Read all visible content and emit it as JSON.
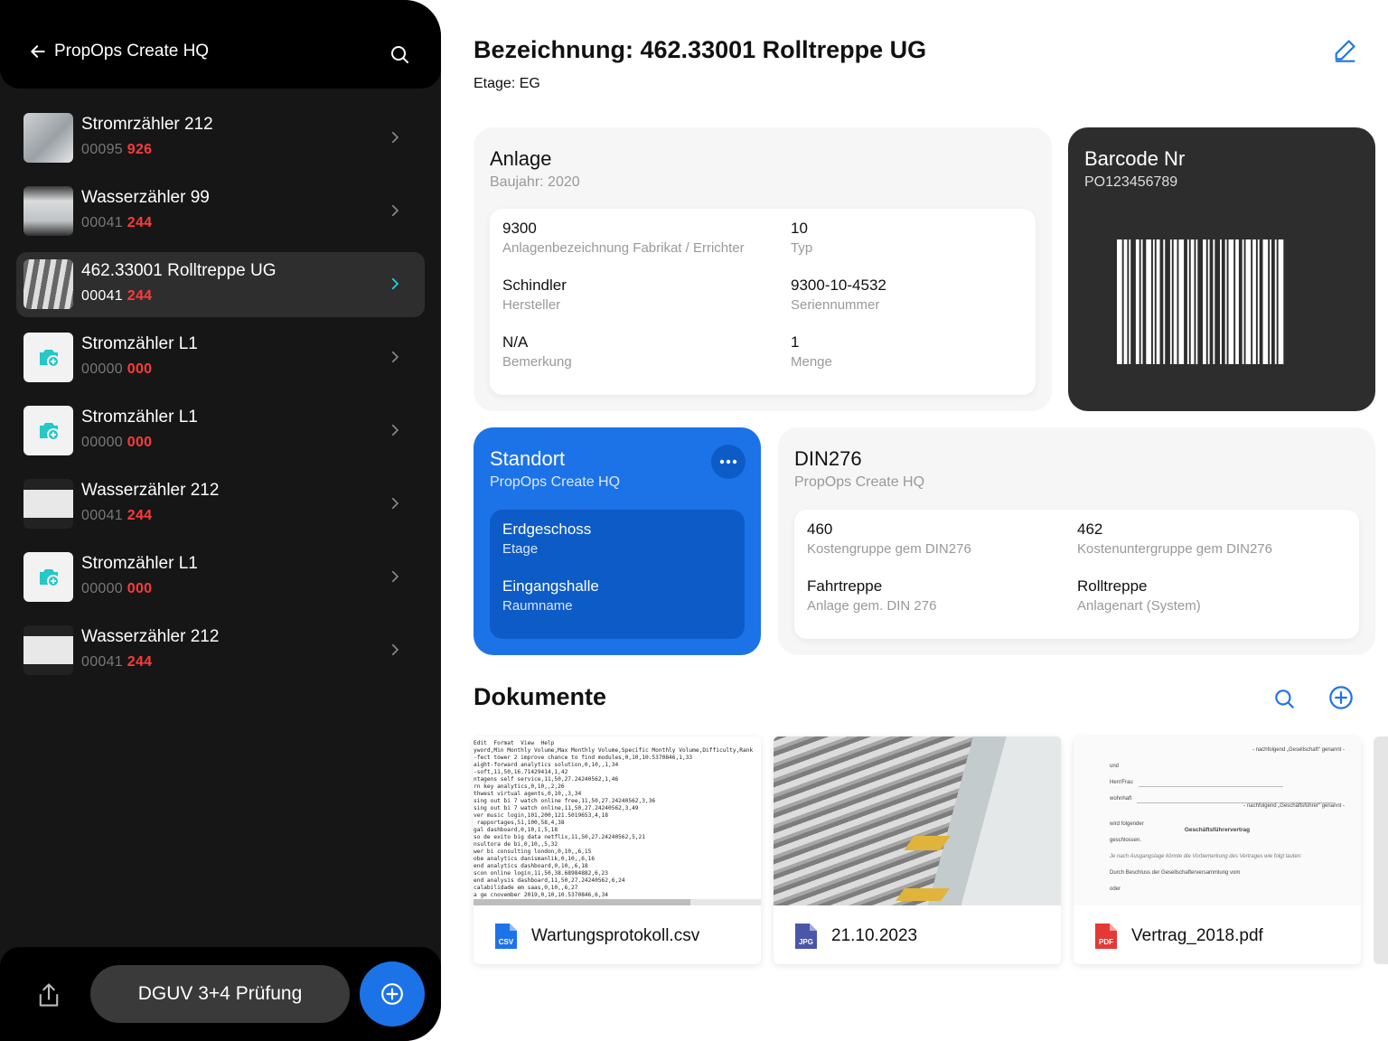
{
  "sidebar": {
    "back_label": "PropOps Create HQ",
    "items": [
      {
        "title": "Stromrzähler 212",
        "code": "00095",
        "reading": "926"
      },
      {
        "title": "Wasserzähler 99",
        "code": "00041",
        "reading": "244"
      },
      {
        "title": "462.33001 Rolltreppe UG",
        "code": "00041",
        "reading": "244"
      },
      {
        "title": "Stromzähler L1",
        "code": "00000",
        "reading": "000"
      },
      {
        "title": "Stromzähler L1",
        "code": "00000",
        "reading": "000"
      },
      {
        "title": "Wasserzähler 212",
        "code": "00041",
        "reading": "244"
      },
      {
        "title": "Stromzähler L1",
        "code": "00000",
        "reading": "000"
      },
      {
        "title": "Wasserzähler 212",
        "code": "00041",
        "reading": "244"
      }
    ],
    "footer": {
      "action_label": "DGUV 3+4 Prüfung"
    }
  },
  "header": {
    "title": "Bezeichnung: 462.33001 Rolltreppe UG",
    "etage": "Etage: EG"
  },
  "anlage": {
    "title": "Anlage",
    "subtitle": "Baujahr: 2020",
    "fields": [
      {
        "value": "9300",
        "label": "Anlagenbezeichnung Fabrikat / Errichter"
      },
      {
        "value": "10",
        "label": "Typ"
      },
      {
        "value": "Schindler",
        "label": "Hersteller"
      },
      {
        "value": "9300-10-4532",
        "label": "Seriennummer"
      },
      {
        "value": "N/A",
        "label": "Bemerkung"
      },
      {
        "value": "1",
        "label": "Menge"
      }
    ]
  },
  "barcode": {
    "title": "Barcode Nr",
    "number": "PO123456789"
  },
  "standort": {
    "title": "Standort",
    "subtitle": "PropOps Create HQ",
    "fields": [
      {
        "value": "Erdgeschoss",
        "label": "Etage"
      },
      {
        "value": "Eingangshalle",
        "label": "Raumname"
      }
    ]
  },
  "din276": {
    "title": "DIN276",
    "subtitle": "PropOps Create HQ",
    "fields": [
      {
        "value": "460",
        "label": "Kostengruppe gem DIN276"
      },
      {
        "value": "462",
        "label": "Kostenuntergruppe gem DIN276"
      },
      {
        "value": "Fahrtreppe",
        "label": "Anlage gem. DIN 276"
      },
      {
        "value": "Rolltreppe",
        "label": "Anlagenart (System)"
      }
    ]
  },
  "documents": {
    "title": "Dokumente",
    "items": [
      {
        "name": "Wartungsprotokoll.csv",
        "type": "CSV",
        "color": "#1c73e8"
      },
      {
        "name": "21.10.2023",
        "type": "JPG",
        "color": "#4a56a8"
      },
      {
        "name": "Vertrag_2018.pdf",
        "type": "PDF",
        "color": "#e53935"
      }
    ],
    "csv_preview": "Edit  Format  View  Help\nyword,Min Monthly Volume,Max Monthly Volume,Specific Monthly Volume,Difficulty,Rank\n-fect tower 2 improve chance to find modules,0,10,10.5370846,1,33\naight-forward analytics solution,0,10,,1,34\n-soft,11,50,16.71429414,1,42\nntagens self service,11,50,27.24240562,1,46\nrn key analytics,0,10,,2,26\nthwest virtual agents,0,10,,3,34\nsing out bi 7 watch online free,11,50,27.24240562,3,36\nsing out bi 7 watch online,11,50,27.24240562,3,49\nver music login,101,200,121.5019653,4,18\n rapportages,51,100,58,4,38\ngal dashboard,0,10,1,5,18\nso de exito big data netflix,11,50,27.24240562,5,21\nnsultora de bi,0,10,,5,32\nwer bi consulting london,0,10,,6,15\nobe analytics danismanlik,0,10,,6,16\nend analytics dashboard,0,10,,6,18\nscon online login,11,50,38.68984882,6,23\nend analysis dashboard,11,50,27.24240562,6,24\ncalabilidade em saas,0,10,,6,27\na ge cnovember 2019,0,10,10.5370846,6,34",
    "pdf_preview": {
      "line1": "- nachfolgend „Gesellschaft“ genannt -",
      "line2": "und",
      "line3": "Herr/Frau",
      "line4": "wohnhaft",
      "line5": "- nachfolgend „Geschäftsführer“ genannt -",
      "line6": "wird folgender",
      "heading": "Geschäftsführervertrag",
      "line7": "geschlossen.",
      "line8": "Je nach Ausgangslage könnte die Vorbemerkung des Vertrages wie folgt lauten:",
      "line9": "Durch Beschluss der Gesellschafterversammlung vom",
      "line10": "oder"
    }
  },
  "colors": {
    "accent": "#1c73e8",
    "danger": "#ff3a3a",
    "sidebar_bg": "#161616"
  }
}
